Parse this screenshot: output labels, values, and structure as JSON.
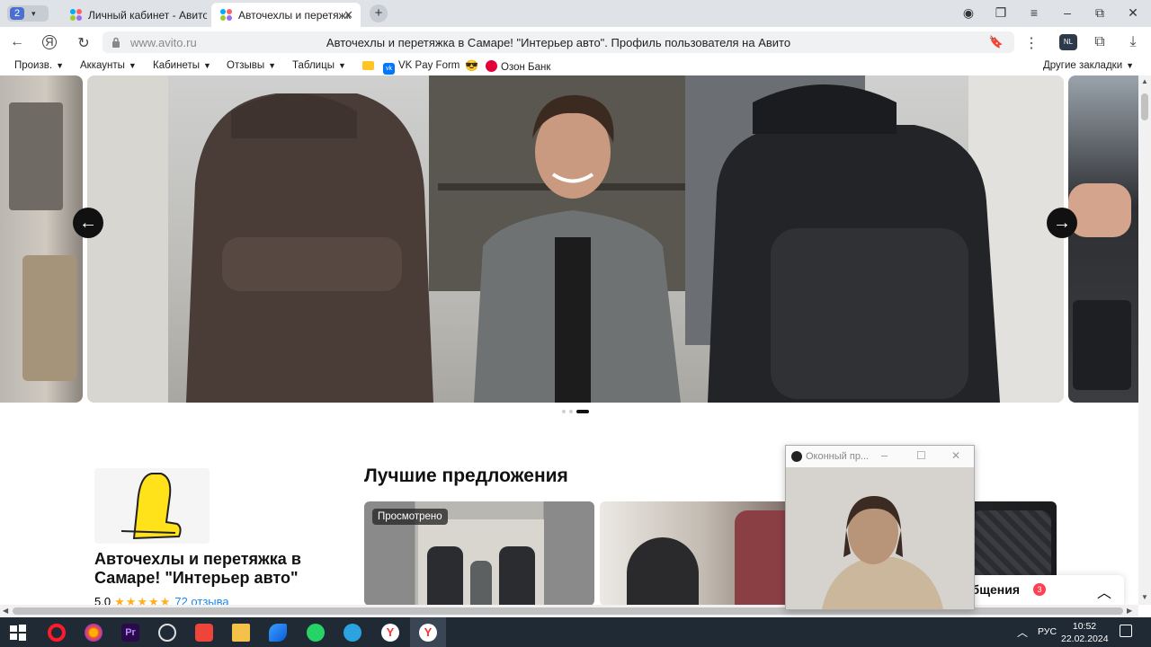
{
  "browser": {
    "tab_count": "2",
    "tabs": [
      {
        "title": "Личный кабинет - Авито"
      },
      {
        "title": "Авточехлы и перетяжк"
      }
    ],
    "url": "www.avito.ru",
    "page_title": "Авточехлы и перетяжка в Самаре! \"Интерьер авто\". Профиль пользователя на Авито"
  },
  "bookmarks": {
    "items": [
      "Произв.",
      "Аккаунты",
      "Кабинеты",
      "Отзывы",
      "Таблицы"
    ],
    "vk": "VK Pay Form",
    "ozon": "Озон Банк",
    "other": "Другие закладки"
  },
  "page": {
    "best_title": "Лучшие предложения",
    "viewed_badge": "Просмотрено",
    "seller_name": "Авточехлы и перетяжка в Самаре! \"Интерьер авто\"",
    "rating": "5.0",
    "stars": "★★★★★",
    "reviews": "72 отзыва",
    "messages_label": "общения",
    "messages_count": "3",
    "carousel_active_slide": 3,
    "carousel_total_slides": 3
  },
  "pip": {
    "title": "Оконный пр..."
  },
  "taskbar": {
    "lang": "РУС",
    "time": "10:52",
    "date": "22.02.2024"
  },
  "colors": {
    "accent_blue": "#1a8af0",
    "star": "#ffb021",
    "badge_red": "#ff4053",
    "taskbar": "#1f2a35"
  }
}
